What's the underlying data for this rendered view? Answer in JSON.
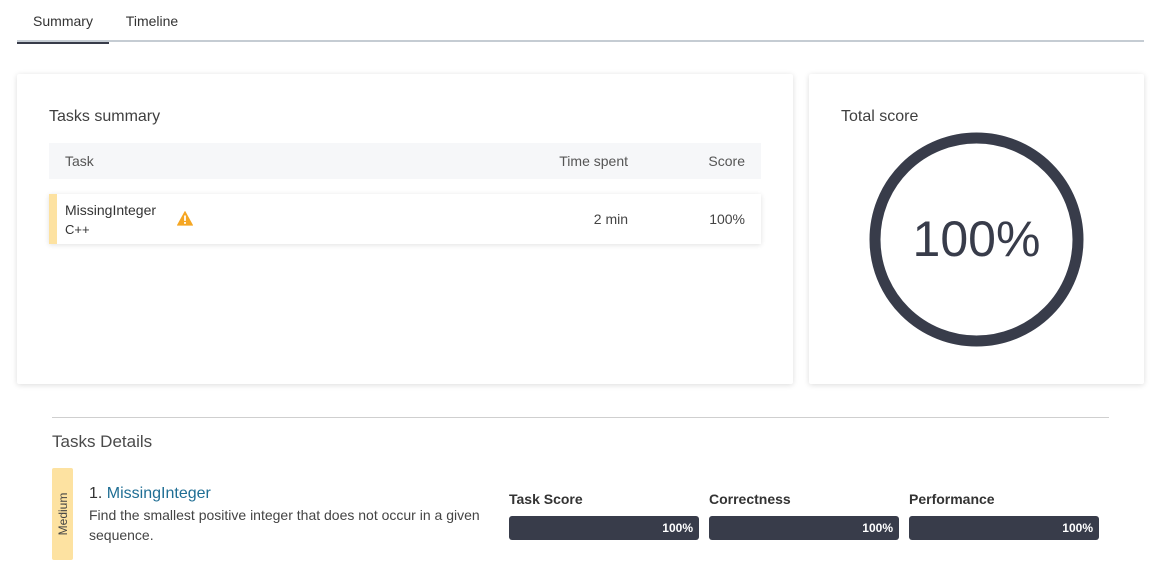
{
  "tabs": {
    "summary": "Summary",
    "timeline": "Timeline"
  },
  "tasks_summary": {
    "title": "Tasks summary",
    "columns": {
      "task": "Task",
      "time_spent": "Time spent",
      "score": "Score"
    },
    "rows": [
      {
        "name": "MissingInteger",
        "language": "C++",
        "time": "2 min",
        "score": "100%",
        "warning_icon": "warning-icon"
      }
    ]
  },
  "total_score": {
    "title": "Total score",
    "value": "100%",
    "fraction": 1.0
  },
  "details": {
    "title": "Tasks Details",
    "task": {
      "difficulty": "Medium",
      "number": "1.",
      "name": "MissingInteger",
      "description": "Find the smallest positive integer that does not occur in a given sequence.",
      "metrics": [
        {
          "label": "Task Score",
          "value": "100%"
        },
        {
          "label": "Correctness",
          "value": "100%"
        },
        {
          "label": "Performance",
          "value": "100%"
        }
      ]
    }
  },
  "colors": {
    "accent": "#383c4a",
    "highlight": "#fde2a1",
    "link": "#1f6e94",
    "warning": "#f5a623"
  }
}
